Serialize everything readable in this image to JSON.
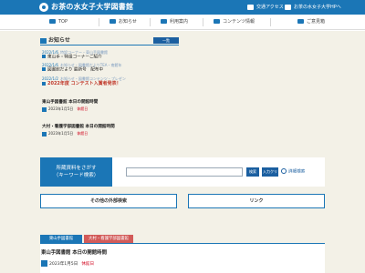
{
  "header": {
    "site_title": "お茶の水女子大学図書館",
    "links": [
      {
        "label": "交通アクセス",
        "icon": "location-icon"
      },
      {
        "label": "お茶の水女子大学HPへ",
        "icon": "home-icon"
      }
    ]
  },
  "nav": [
    {
      "label": "TOP",
      "icon": "home-icon"
    },
    {
      "label": "お知らせ",
      "icon": "megaphone-icon"
    },
    {
      "label": "利用案内",
      "icon": "book-icon"
    },
    {
      "label": "コンテンツ情報",
      "icon": "monitor-icon"
    },
    {
      "label": "ご意見箱",
      "icon": "mailbox-icon"
    }
  ],
  "news": {
    "heading": "お知らせ",
    "list_button": "一覧",
    "items": [
      {
        "date": "2022/1/6",
        "category": "特設コーナー・東山手図書館",
        "title": "東山手・特設コーナーご紹介",
        "highlight": false
      },
      {
        "date": "2022/1/6",
        "category": "お知らせ・図書館だよりTEA・南館年",
        "title": "図書館だより 最新号　配布中",
        "highlight": false
      },
      {
        "date": "2022/1/2",
        "category": "お知らせ・図書館コンテンツ・プレゼン",
        "title": "2022年度 コンテスト入賞者発表！",
        "highlight": true
      }
    ]
  },
  "hours": [
    {
      "title": "東山手図書館 本日の開館時間",
      "date": "2023年1月5日",
      "status": "休館日"
    },
    {
      "title": "大村・看護学部図書館 本日の開館時間",
      "date": "2023年1月5日",
      "status": "休館日"
    }
  ],
  "search": {
    "label_line1": "所蔵資料をさがす",
    "label_line2": "（キーワード検索）",
    "input_value": "",
    "button_search": "検索",
    "button_clear": "入力クリア",
    "advanced_link": "詳細検索"
  },
  "links": [
    {
      "label": "その他の外部検索"
    },
    {
      "label": "リンク"
    }
  ],
  "tabs": [
    {
      "label": "東山手図書館",
      "active": true
    },
    {
      "label": "大村・看護学部図書館",
      "active": false
    }
  ],
  "panel": {
    "title": "東山手図書館 本日の開館時間",
    "date": "2023年1月5日",
    "status": "休館日"
  },
  "colors": {
    "brand_blue": "#1b76b6",
    "background": "#f3f1e7",
    "closed_red": "#d0021b",
    "inactive_tab": "#d25b59"
  }
}
